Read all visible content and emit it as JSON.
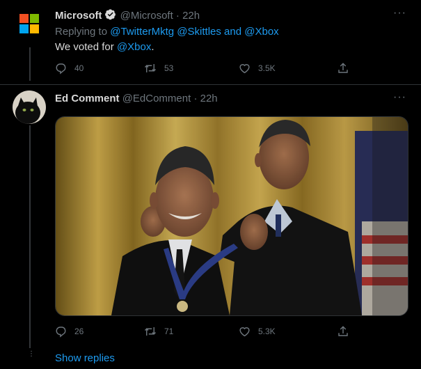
{
  "tweet1": {
    "name": "Microsoft",
    "handle": "@Microsoft",
    "dot": "·",
    "time": "22h",
    "more": "···",
    "replying_label": "Replying to",
    "replying_to": [
      "@TwitterMktg",
      "@Skittles"
    ],
    "replying_and": "and",
    "replying_last": "@Xbox",
    "text_prefix": "We voted for",
    "text_mention": "@Xbox",
    "text_suffix": ".",
    "actions": {
      "reply": "40",
      "retweet": "53",
      "like": "3.5K"
    }
  },
  "tweet2": {
    "name": "Ed Comment",
    "handle": "@EdComment",
    "dot": "·",
    "time": "22h",
    "more": "···",
    "actions": {
      "reply": "26",
      "retweet": "71",
      "like": "5.3K"
    }
  },
  "footer": {
    "dots": "⋮",
    "show_replies": "Show replies"
  },
  "colors": {
    "background": "#000000",
    "accent": "#1d9bf0",
    "muted": "#6e767d",
    "text": "#d9d9d9"
  },
  "icons": {
    "reply": "reply-icon",
    "retweet": "retweet-icon",
    "like": "heart-icon",
    "share": "share-icon",
    "verified": "verified-badge-icon"
  }
}
